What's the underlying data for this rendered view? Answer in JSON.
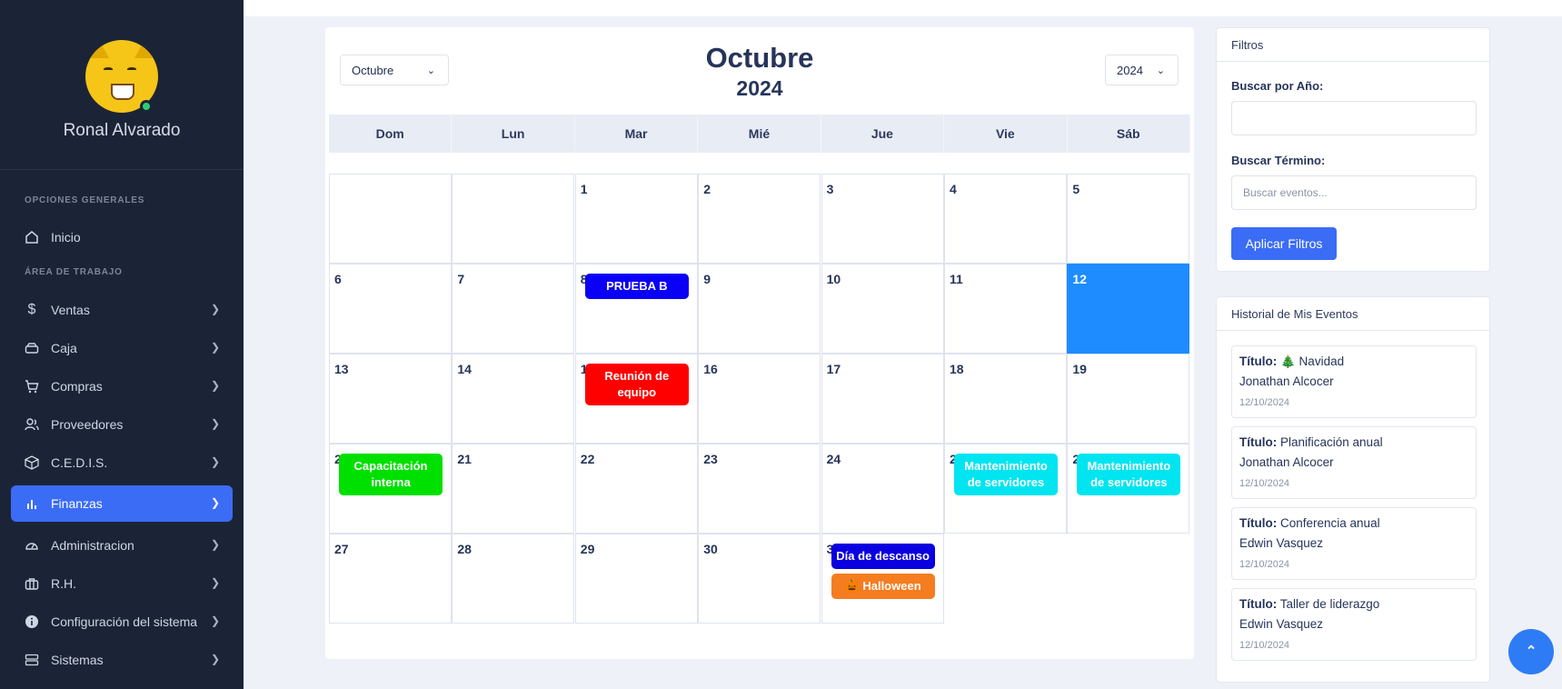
{
  "user": {
    "name": "Ronal Alvarado"
  },
  "sidebar": {
    "section_general": "OPCIONES GENERALES",
    "section_work": "ÁREA DE TRABAJO",
    "items": [
      {
        "label": "Inicio",
        "icon": "home-icon"
      },
      {
        "label": "Ventas",
        "icon": "dollar-icon"
      },
      {
        "label": "Caja",
        "icon": "cash-drawer-icon"
      },
      {
        "label": "Compras",
        "icon": "cart-icon"
      },
      {
        "label": "Proveedores",
        "icon": "users-icon"
      },
      {
        "label": "C.E.D.I.S.",
        "icon": "box-icon"
      },
      {
        "label": "Finanzas",
        "icon": "bar-chart-icon"
      },
      {
        "label": "Administracion",
        "icon": "gauge-icon"
      },
      {
        "label": "R.H.",
        "icon": "briefcase-icon"
      },
      {
        "label": "Configuración del sistema",
        "icon": "info-icon"
      },
      {
        "label": "Sistemas",
        "icon": "server-icon"
      }
    ],
    "active_item": "Finanzas"
  },
  "calendar": {
    "month_select": "Octubre",
    "year_select": "2024",
    "month_title": "Octubre",
    "year_title": "2024",
    "weekdays": [
      "Dom",
      "Lun",
      "Mar",
      "Mié",
      "Jue",
      "Vie",
      "Sáb"
    ],
    "today": 12,
    "events": [
      {
        "day": 8,
        "title": "PRUEBA B",
        "color": "#0a00f5"
      },
      {
        "day": 15,
        "title": "Reunión de equipo",
        "color": "#ff0000"
      },
      {
        "day": 20,
        "title": "Capacitación interna",
        "color": "#00e000"
      },
      {
        "day": 25,
        "title": "Mantenimiento de servidores",
        "color": "#00e5f0"
      },
      {
        "day": 26,
        "title": "Mantenimiento de servidores",
        "color": "#00e5f0"
      },
      {
        "day": 31,
        "title": "Día de descanso",
        "color": "#0a00e0"
      },
      {
        "day": 31,
        "title": "🎃 Halloween",
        "color": "#f57c1f"
      }
    ]
  },
  "filters": {
    "heading": "Filtros",
    "year_label": "Buscar por Año:",
    "year_value": "",
    "term_label": "Buscar Término:",
    "term_placeholder": "Buscar eventos...",
    "apply_button": "Aplicar Filtros"
  },
  "history": {
    "heading": "Historial de Mis Eventos",
    "title_prefix": "Título:",
    "items": [
      {
        "title": "🎄 Navidad",
        "author": "Jonathan Alcocer",
        "date": "12/10/2024"
      },
      {
        "title": "Planificación anual",
        "author": "Jonathan Alcocer",
        "date": "12/10/2024"
      },
      {
        "title": "Conferencia anual",
        "author": "Edwin Vasquez",
        "date": "12/10/2024"
      },
      {
        "title": "Taller de liderazgo",
        "author": "Edwin Vasquez",
        "date": "12/10/2024"
      }
    ]
  },
  "scroll_top_icon": "double-chevron-up-icon"
}
